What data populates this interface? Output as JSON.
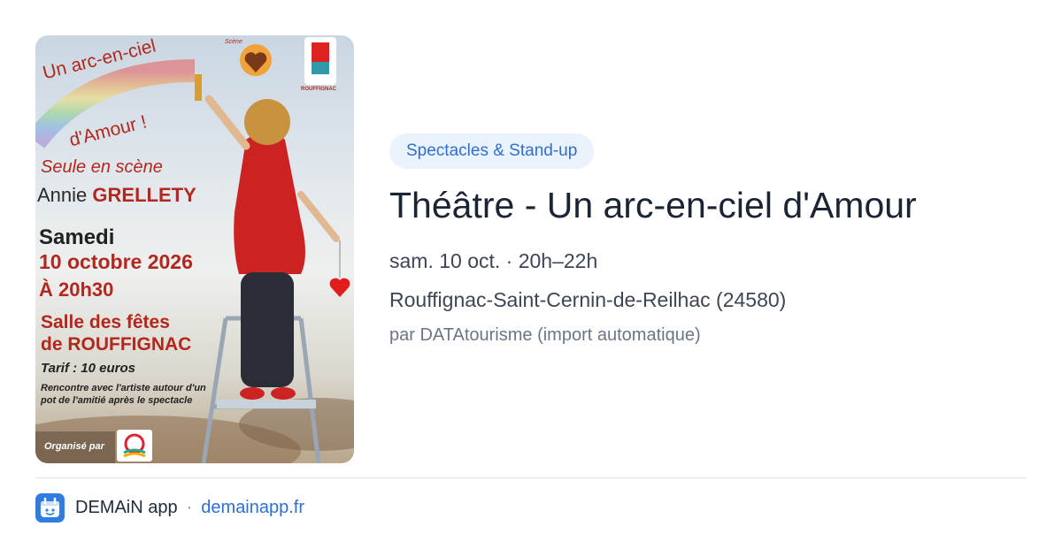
{
  "poster": {
    "title_line1": "Un arc-en-ciel",
    "title_line2": "d'Amour !",
    "subtitle": "Seule en scène",
    "artist_first": "Annie",
    "artist_last": "GRELLETY",
    "day": "Samedi",
    "date": "10 octobre 2026",
    "time": "À 20h30",
    "venue_line1": "Salle des fêtes",
    "venue_line2": "de ROUFFIGNAC",
    "price": "Tarif : 10 euros",
    "meeting": "Rencontre avec l'artiste autour d'un pot de l'amitié après le spectacle",
    "organizer_label": "Organisé par",
    "logo_text": "Scène",
    "rouffignac_logo_text": "ROUFFIGNAC"
  },
  "event": {
    "category": "Spectacles & Stand-up",
    "title": "Théâtre - Un arc-en-ciel d'Amour",
    "datetime": "sam. 10 oct. · 20h–22h",
    "location": "Rouffignac-Saint-Cernin-de-Reilhac (24580)",
    "source": "par DATAtourisme (import automatique)"
  },
  "footer": {
    "app_name": "DEMAiN app",
    "separator": "·",
    "website": "demainapp.fr"
  },
  "colors": {
    "accent": "#2f6fd0",
    "badge_bg": "#eaf2fc",
    "poster_red": "#b2281e"
  },
  "icons": {
    "app": "demain-app-icon"
  }
}
